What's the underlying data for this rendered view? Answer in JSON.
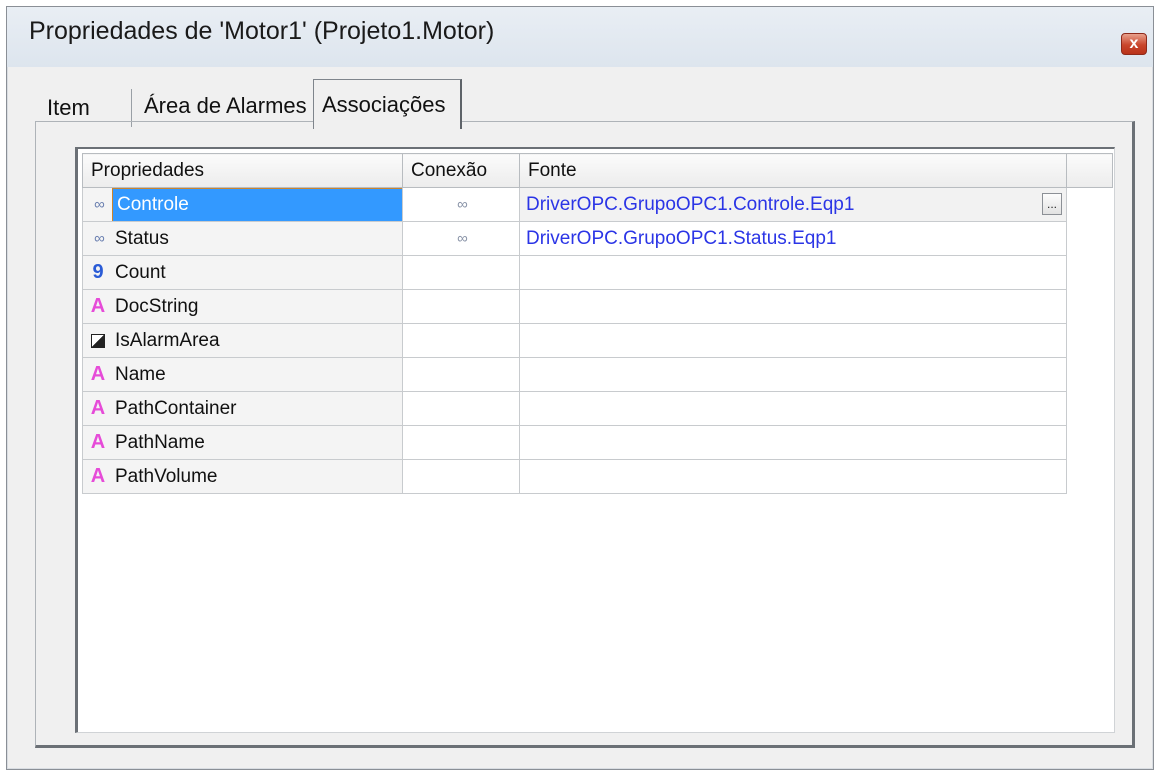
{
  "window": {
    "title": "Propriedades de 'Motor1' (Projeto1.Motor)",
    "close_glyph": "x"
  },
  "tabs": [
    {
      "label": "Item",
      "selected": false
    },
    {
      "label": "Área de Alarmes",
      "selected": false
    },
    {
      "label": "Associações",
      "selected": true
    }
  ],
  "grid": {
    "columns": [
      "Propriedades",
      "Conexão",
      "Fonte"
    ],
    "rows": [
      {
        "icon": "link-icon",
        "name": "Controle",
        "connection_icon": "link-icon",
        "source": "DriverOPC.GrupoOPC1.Controle.Eqp1",
        "selected": true
      },
      {
        "icon": "link-icon",
        "name": "Status",
        "connection_icon": "link-icon",
        "source": "DriverOPC.GrupoOPC1.Status.Eqp1"
      },
      {
        "icon": "integer-icon",
        "name": "Count"
      },
      {
        "icon": "string-icon",
        "name": "DocString"
      },
      {
        "icon": "boolean-icon",
        "name": "IsAlarmArea"
      },
      {
        "icon": "string-icon",
        "name": "Name"
      },
      {
        "icon": "string-icon",
        "name": "PathContainer"
      },
      {
        "icon": "string-icon",
        "name": "PathName"
      },
      {
        "icon": "string-icon",
        "name": "PathVolume"
      }
    ],
    "ellipsis_label": "..."
  },
  "icon_glyphs": {
    "integer-icon": "9",
    "string-icon": "A"
  },
  "colors": {
    "selection": "#3399ff",
    "source_text": "#2b35e6",
    "string_icon": "#e64bd8",
    "integer_icon": "#2a5bd6"
  }
}
